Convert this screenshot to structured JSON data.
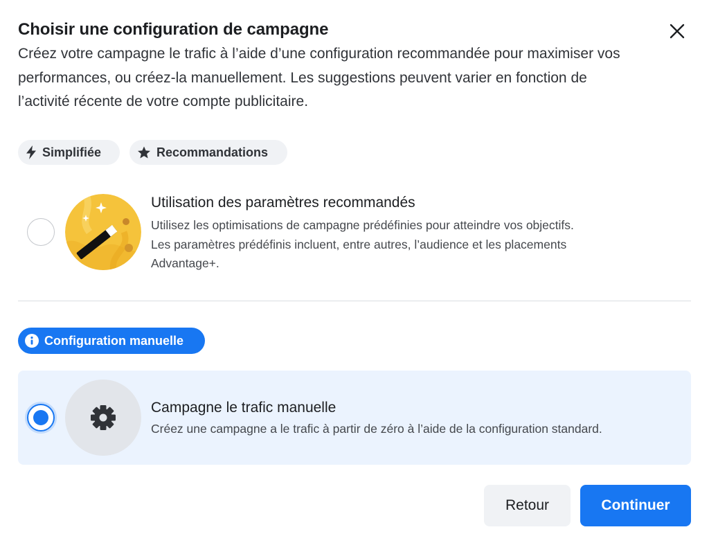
{
  "dialog": {
    "title": "Choisir une configuration de campagne",
    "description": "Créez votre campagne le trafic à l’aide d’une configuration recommandée pour maximiser vos performances, ou créez-la manuellement. Les suggestions peuvent varier en fonction de l’activité récente de votre compte publicitaire.",
    "close_icon": "close-icon"
  },
  "chips": {
    "simplified": {
      "label": "Simplifiée",
      "icon": "lightning-icon"
    },
    "recommendations": {
      "label": "Recommandations",
      "icon": "star-icon"
    }
  },
  "recommended_option": {
    "title": "Utilisation des paramètres recommandés",
    "description_line1": "Utilisez les optimisations de campagne prédéfinies pour atteindre vos objectifs.",
    "description_line2": "Les paramètres prédéfinis incluent, entre autres, l’audience et les placements",
    "description_line3": "Advantage+.",
    "selected": false,
    "icon": "magic-wand-icon"
  },
  "manual_badge": {
    "label": "Configuration manuelle",
    "icon": "info-icon"
  },
  "manual_option": {
    "title": "Campagne le trafic manuelle",
    "description": "Créez une campagne a le trafic à partir de zéro à l’aide de la configuration standard.",
    "selected": true,
    "icon": "gear-icon"
  },
  "footer": {
    "back_label": "Retour",
    "continue_label": "Continuer"
  },
  "colors": {
    "accent": "#1877f2",
    "card_background": "#ebf3fe",
    "chip_background": "#f0f2f5",
    "illustration_gold": "#f5c33b"
  }
}
